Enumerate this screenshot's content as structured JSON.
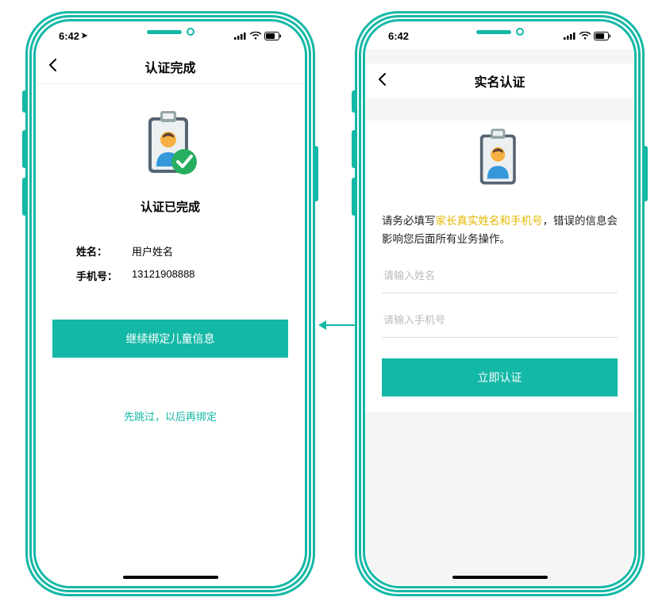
{
  "status": {
    "time": "6:42",
    "locationGlyph": "➤"
  },
  "left": {
    "navTitle": "认证完成",
    "completed": "认证已完成",
    "nameLabel": "姓名：",
    "nameValue": "用户姓名",
    "phoneLabel": "手机号：",
    "phoneValue": "13121908888",
    "primaryBtn": "继续绑定儿童信息",
    "skip": "先跳过，以后再绑定"
  },
  "right": {
    "navTitle": "实名认证",
    "instrPrefix": "请务必填写",
    "instrHighlight": "家长真实姓名和手机号",
    "instrSuffix": "，错误的信息会影响您后面所有业务操作。",
    "namePlaceholder": "请输入姓名",
    "phonePlaceholder": "请输入手机号",
    "primaryBtn": "立即认证"
  },
  "colors": {
    "accent": "#14b8a6",
    "highlight": "#e6b800"
  }
}
